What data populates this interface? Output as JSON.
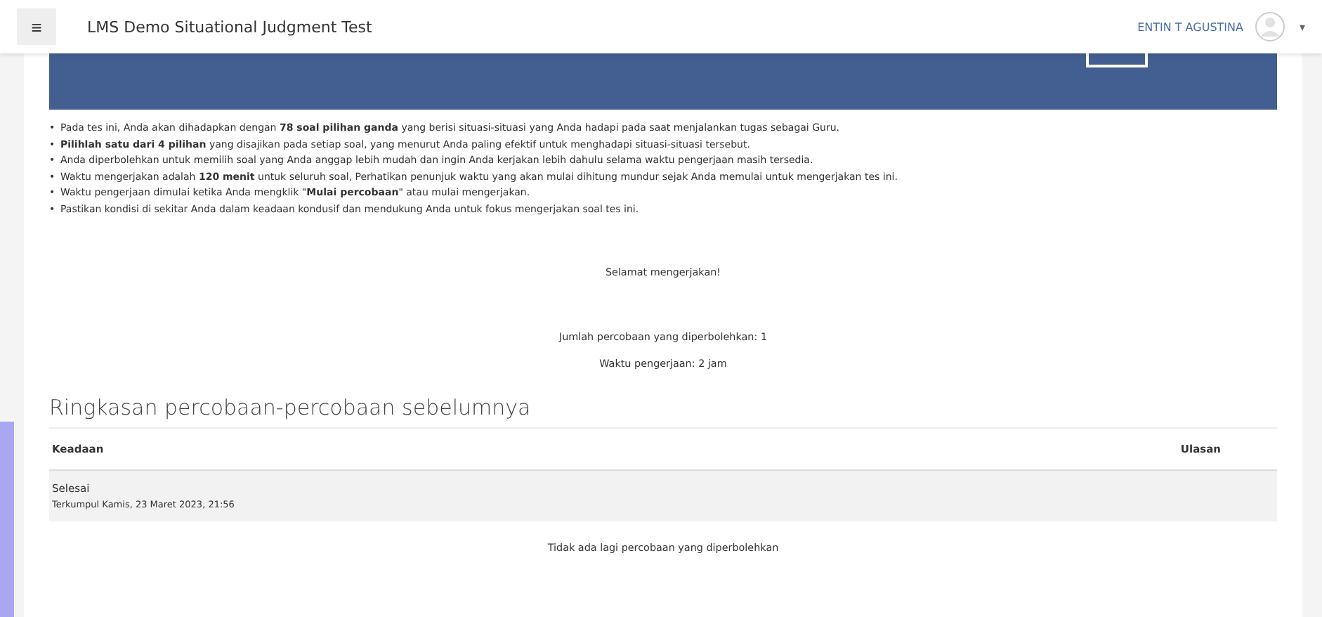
{
  "navbar": {
    "menu_icon": "≡",
    "site_title": "LMS Demo Situational Judgment Test",
    "user_name": "ENTIN T AGUSTINA",
    "dropdown_caret": "▾"
  },
  "bullet_marker": "•",
  "instructions": [
    "Pada tes ini, Anda akan dihadapkan dengan **78 soal pilihan ganda** yang berisi situasi-situasi yang Anda hadapi pada saat menjalankan tugas sebagai Guru.",
    "**Pilihlah satu dari 4 pilihan** yang disajikan pada setiap soal, yang menurut Anda paling efektif untuk menghadapi situasi-situasi tersebut.",
    "Anda diperbolehkan untuk memilih soal yang Anda anggap lebih mudah dan ingin Anda kerjakan lebih dahulu selama waktu pengerjaan masih tersedia.",
    "Waktu mengerjakan adalah **120 menit** untuk seluruh soal, Perhatikan penunjuk waktu yang akan mulai dihitung mundur sejak Anda memulai untuk mengerjakan tes ini.",
    "Waktu pengerjaan dimulai ketika Anda mengklik \"**Mulai percobaan**\" atau mulai mengerjakan.",
    "Pastikan kondisi di sekitar Anda dalam keadaan kondusif dan mendukung Anda untuk fokus mengerjakan soal tes ini."
  ],
  "greeting": "Selamat mengerjakan!",
  "attempts_allowed": "Jumlah percobaan yang diperbolehkan: 1",
  "time_limit": "Waktu pengerjaan: 2 jam",
  "summary": {
    "heading": "Ringkasan percobaan-percobaan sebelumnya",
    "columns": [
      "Keadaan",
      "Ulasan"
    ],
    "rows": [
      {
        "status": "Selesai",
        "submitted": "Terkumpul Kamis, 23 Maret 2023, 21:56"
      }
    ]
  },
  "no_more_attempts": "Tidak ada lagi percobaan yang diperbolehkan"
}
